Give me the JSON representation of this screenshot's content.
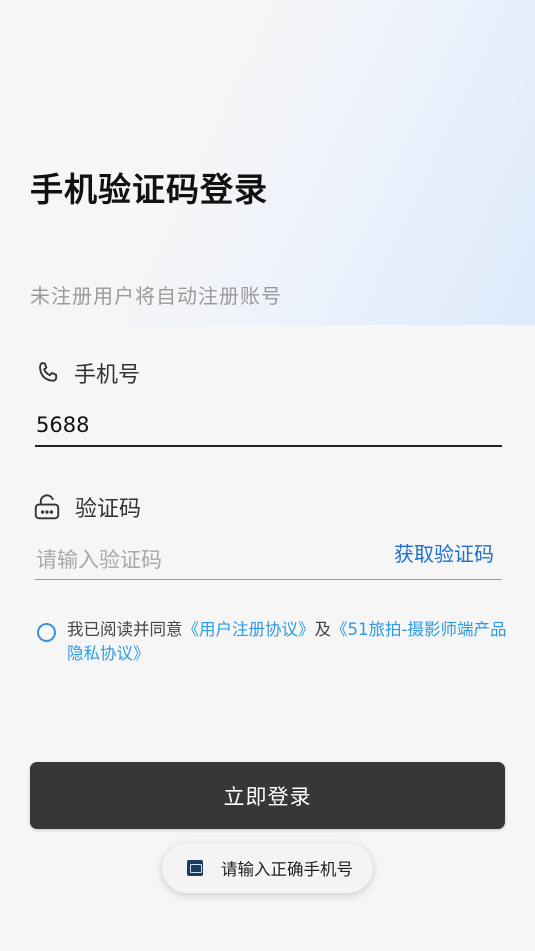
{
  "header": {
    "title": "手机验证码登录",
    "subtitle": "未注册用户将自动注册账号"
  },
  "phone": {
    "label": "手机号",
    "value": "5688",
    "icon": "phone-icon"
  },
  "code": {
    "label": "验证码",
    "placeholder": "请输入验证码",
    "get_code_label": "获取验证码",
    "icon": "lock-icon"
  },
  "agreement": {
    "prefix": "我已阅读并同意",
    "link1": "《用户注册协议》",
    "middle": "及",
    "link2": "《51旅拍-摄影师端产品隐私协议》",
    "checked": false
  },
  "login_button": "立即登录",
  "toast": {
    "text": "请输入正确手机号",
    "icon": "app-icon"
  },
  "colors": {
    "accent": "#1f6fd1",
    "link": "#2e9be6",
    "button": "#373737",
    "radio": "#3d8fe0"
  }
}
